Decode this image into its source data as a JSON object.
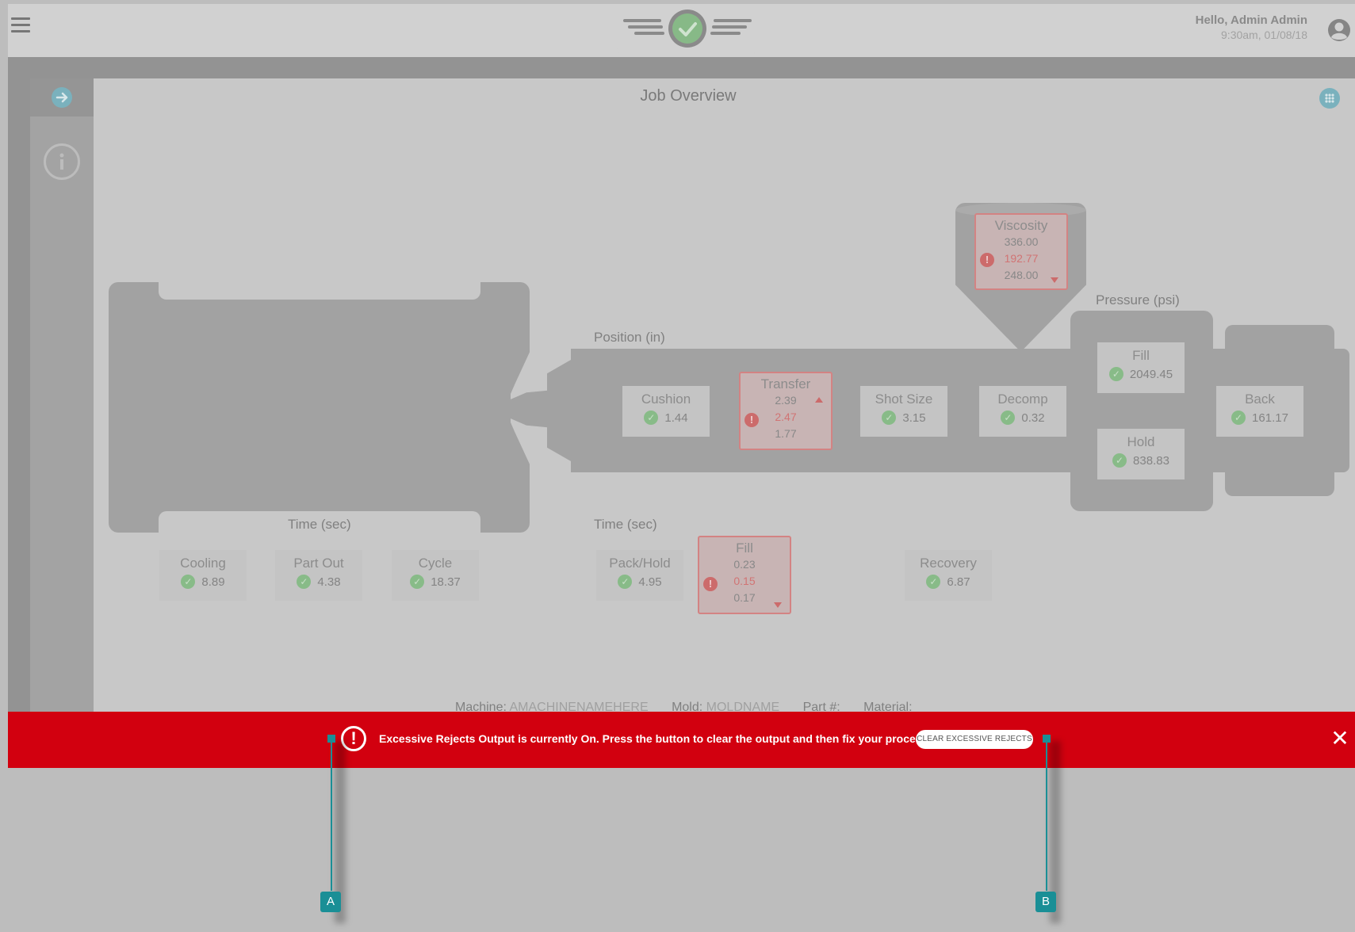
{
  "header": {
    "greeting": "Hello, Admin Admin",
    "datetime": "9:30am, 01/08/18"
  },
  "page": {
    "title": "Job Overview"
  },
  "sections": {
    "position": "Position (in)",
    "pressure": "Pressure (psi)",
    "time_clamp": "Time (sec)",
    "time_injection": "Time (sec)"
  },
  "cards": {
    "cushion": {
      "label": "Cushion",
      "value": "1.44"
    },
    "shot_size": {
      "label": "Shot Size",
      "value": "3.15"
    },
    "decomp": {
      "label": "Decomp",
      "value": "0.32"
    },
    "fill_pressure": {
      "label": "Fill",
      "value": "2049.45"
    },
    "hold_pressure": {
      "label": "Hold",
      "value": "838.83"
    },
    "back": {
      "label": "Back",
      "value": "161.17"
    },
    "cooling": {
      "label": "Cooling",
      "value": "8.89"
    },
    "part_out": {
      "label": "Part Out",
      "value": "4.38"
    },
    "cycle": {
      "label": "Cycle",
      "value": "18.37"
    },
    "pack_hold": {
      "label": "Pack/Hold",
      "value": "4.95"
    },
    "recovery": {
      "label": "Recovery",
      "value": "6.87"
    }
  },
  "alerts": {
    "viscosity": {
      "label": "Viscosity",
      "upper": "336.00",
      "current": "192.77",
      "lower": "248.00"
    },
    "transfer": {
      "label": "Transfer",
      "upper": "2.39",
      "current": "2.47",
      "lower": "1.77"
    },
    "fill_time": {
      "label": "Fill",
      "upper": "0.23",
      "current": "0.15",
      "lower": "0.17"
    }
  },
  "machine_info": {
    "machine_label": "Machine:",
    "machine_value": "AMACHINENAMEHERE",
    "mold_label": "Mold:",
    "mold_value": "MOLDNAME",
    "part_label": "Part #:",
    "material_label": "Material:"
  },
  "banner": {
    "message": "Excessive Rejects Output is currently On. Press the button to clear the output and then fix your process.",
    "button_label": "CLEAR EXCESSIVE REJECTS",
    "close_glyph": "✕"
  },
  "callouts": {
    "a": "A",
    "b": "B"
  },
  "icons": {
    "menu": "hamburger-icon",
    "user": "user-account-icon",
    "arrow": "arrow-right-icon",
    "info": "info-icon",
    "apps": "apps-grid-icon",
    "ok": "check-circle-icon",
    "error": "exclamation-circle-icon"
  },
  "colors": {
    "banner": "#d2000f",
    "callout": "#1a8f96",
    "accent": "#7ab1bd"
  }
}
